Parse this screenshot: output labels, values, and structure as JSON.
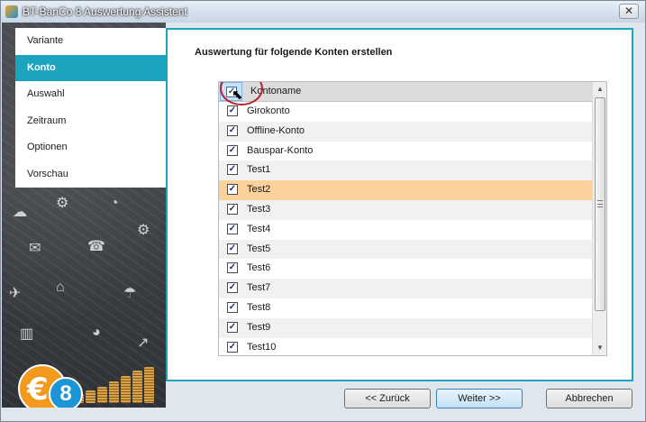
{
  "window": {
    "title": "BT-BanCo 8 Auswertung Assistent",
    "close_glyph": "✕"
  },
  "sidebar": {
    "items": [
      {
        "label": "Variante",
        "active": false
      },
      {
        "label": "Konto",
        "active": true
      },
      {
        "label": "Auswahl",
        "active": false
      },
      {
        "label": "Zeitraum",
        "active": false
      },
      {
        "label": "Optionen",
        "active": false
      },
      {
        "label": "Vorschau",
        "active": false
      }
    ],
    "logo_euro": "€",
    "logo_eight": "8"
  },
  "main": {
    "heading": "Auswertung für folgende Konten erstellen",
    "column_header": "Kontoname",
    "header_checked": true,
    "rows": [
      {
        "label": "Girokonto",
        "checked": true,
        "selected": false
      },
      {
        "label": "Offline-Konto",
        "checked": true,
        "selected": false
      },
      {
        "label": "Bauspar-Konto",
        "checked": true,
        "selected": false
      },
      {
        "label": "Test1",
        "checked": true,
        "selected": false
      },
      {
        "label": "Test2",
        "checked": true,
        "selected": true
      },
      {
        "label": "Test3",
        "checked": true,
        "selected": false
      },
      {
        "label": "Test4",
        "checked": true,
        "selected": false
      },
      {
        "label": "Test5",
        "checked": true,
        "selected": false
      },
      {
        "label": "Test6",
        "checked": true,
        "selected": false
      },
      {
        "label": "Test7",
        "checked": true,
        "selected": false
      },
      {
        "label": "Test8",
        "checked": true,
        "selected": false
      },
      {
        "label": "Test9",
        "checked": true,
        "selected": false
      },
      {
        "label": "Test10",
        "checked": true,
        "selected": false
      }
    ]
  },
  "footer": {
    "back_label": "<< Zurück",
    "next_label": "Weiter >>",
    "cancel_label": "Abbrechen"
  },
  "colors": {
    "accent": "#1ba3bf",
    "selected_row": "#fbd39a",
    "highlight_ring": "#b3242b"
  }
}
